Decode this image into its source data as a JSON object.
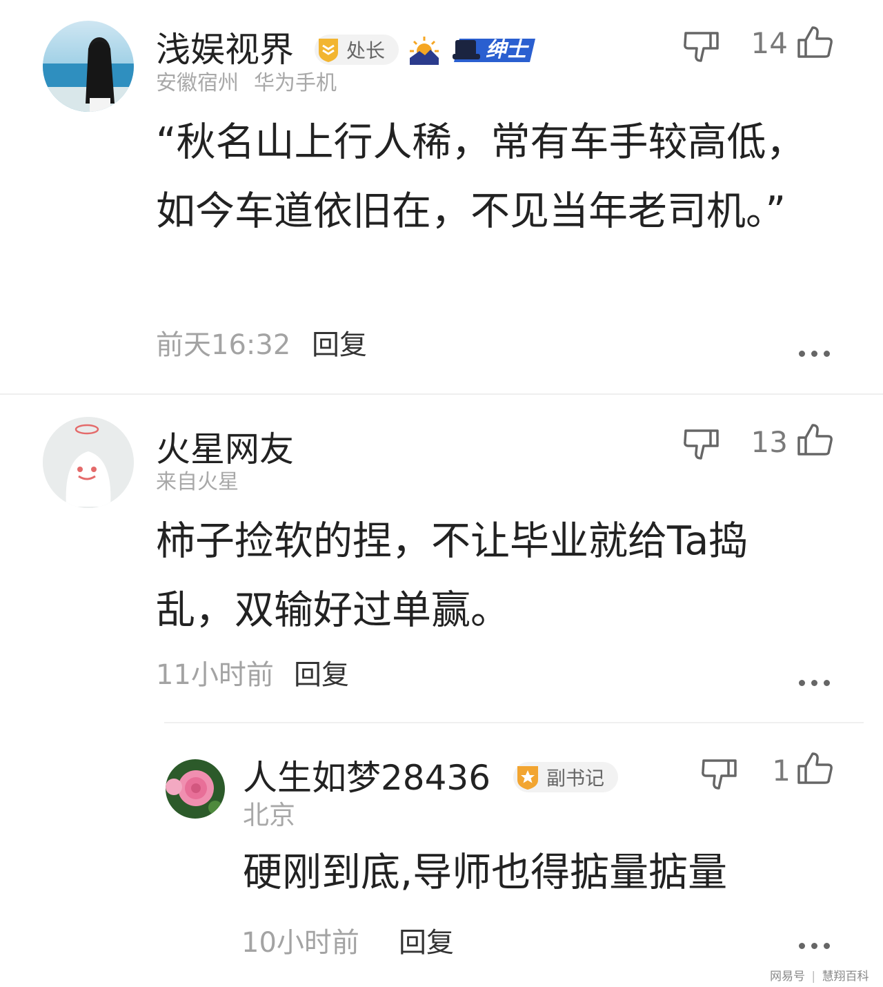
{
  "comments": [
    {
      "username": "浅娱视界",
      "badge": "处长",
      "medal_icon": "sunrise-icon",
      "tag": "绅士",
      "location": "安徽宿州",
      "device": "华为手机",
      "text": "“秋名山上行人稀，常有车手较高低，如今车道依旧在，不见当年老司机。”",
      "time": "前天16:32",
      "reply_label": "回复",
      "likes": "14"
    },
    {
      "username": "火星网友",
      "location": "来自火星",
      "text": "柿子捡软的捏，不让毕业就给Ta捣乱，双输好过单赢。",
      "time": "11小时前",
      "reply_label": "回复",
      "likes": "13",
      "reply": {
        "username": "人生如梦28436",
        "badge": "副书记",
        "location": "北京",
        "text": "硬刚到底,导师也得掂量掂量",
        "time": "10小时前",
        "reply_label": "回复",
        "likes": "1"
      }
    }
  ],
  "watermark": {
    "left": "网易号",
    "right": "慧翔百科"
  },
  "colors": {
    "badge_gold": "#f2b531",
    "tag_blue": "#2a5fd0",
    "text": "#222222",
    "muted": "#a8a8a8"
  }
}
